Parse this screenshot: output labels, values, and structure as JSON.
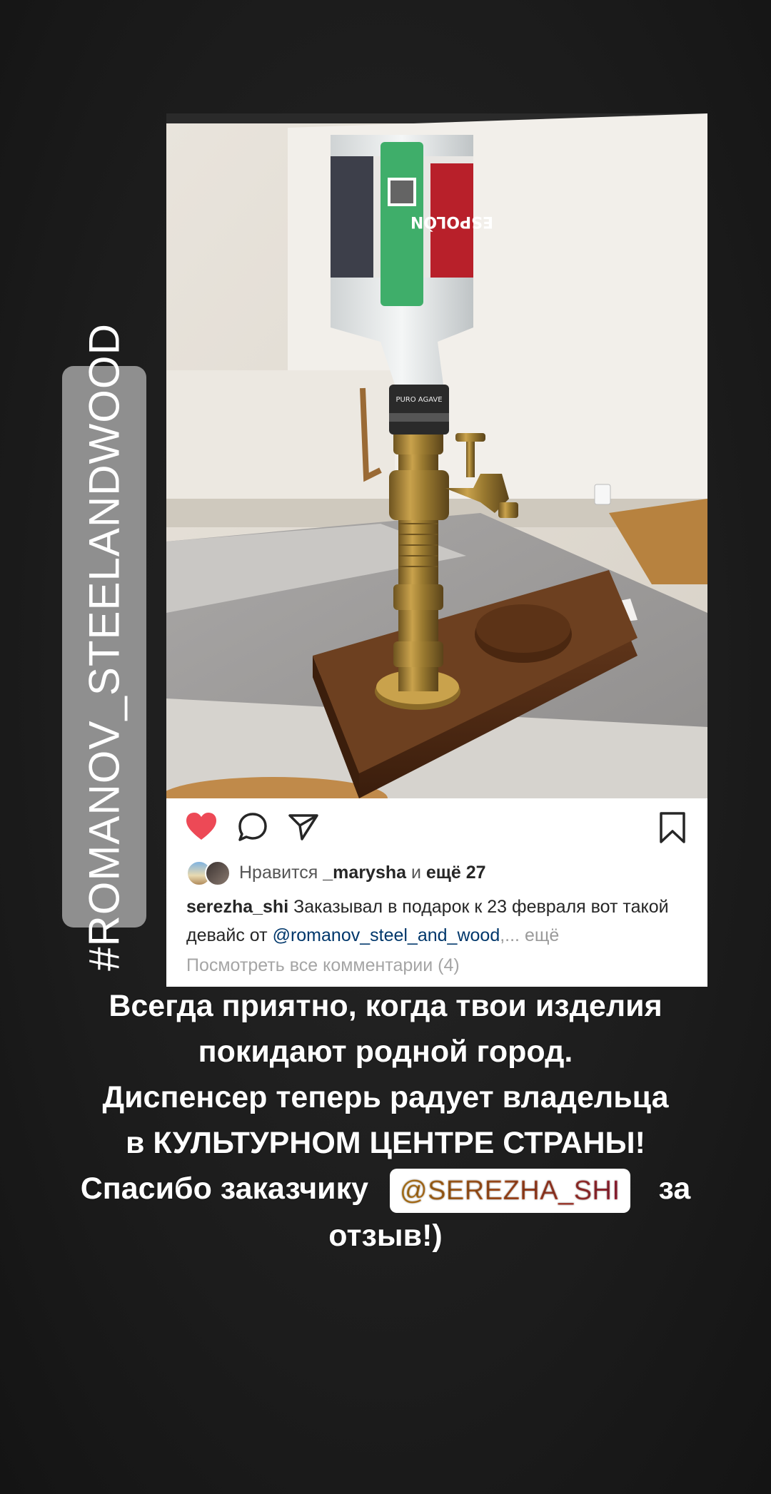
{
  "hashtag_sticker": {
    "text": "#ROMANOV_STEELANDWOOD"
  },
  "post": {
    "photo": {
      "subject_icon": "bottle-dispenser-photo",
      "bottle_label_text": "ESPOLÒN",
      "cap_text": "PURO AGAVE"
    },
    "actions": {
      "like_icon": "heart-filled-icon",
      "comment_icon": "comment-bubble-icon",
      "share_icon": "paper-plane-icon",
      "save_icon": "bookmark-icon",
      "like_color": "#ed4956"
    },
    "likes": {
      "prefix": "Нравится",
      "user": "_marysha",
      "conjunction": "и",
      "others": "ещё 27"
    },
    "caption": {
      "username": "serezha_shi",
      "text_part1": "Заказывал в подарок к 23 февраля вот такой девайс от",
      "mention": "@romanov_steel_and_wood",
      "ellipsis": ",... ещё"
    },
    "view_comments": "Посмотреть все комментарии (4)"
  },
  "story_text": {
    "line1": "Всегда приятно, когда твои изделия",
    "line2": "покидают родной город.",
    "line3": "Диспенсер теперь радует владельца",
    "line4": "в КУЛЬТУРНОМ ЦЕНТРЕ СТРАНЫ!",
    "line5_before": "Спасибо заказчику",
    "mention_sticker": "@SEREZHA_SHI",
    "line5_after": "за",
    "line6": "отзыв!)"
  }
}
